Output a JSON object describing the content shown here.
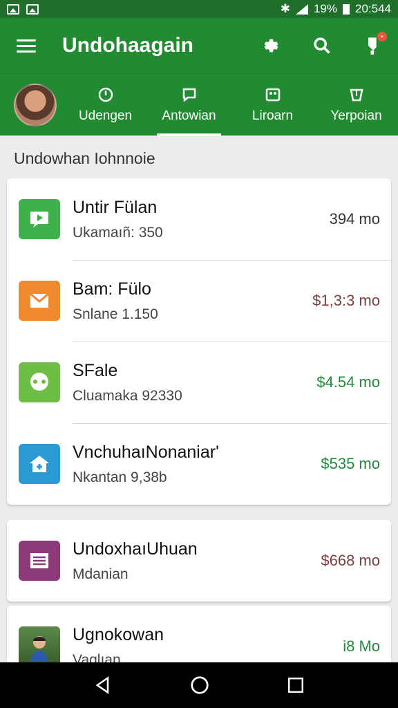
{
  "status_bar": {
    "battery": "19%",
    "time": "20:544"
  },
  "app_bar": {
    "title": "Undohaagain"
  },
  "tabs": [
    {
      "label": "Udengen"
    },
    {
      "label": "Antowian"
    },
    {
      "label": "Liroarn"
    },
    {
      "label": "Yerpoian"
    }
  ],
  "section": {
    "title": "Undowhan Iohnnoie"
  },
  "items": [
    {
      "title": "Untir Fülan",
      "subtitle": "Ukamaıñ: 350",
      "price": "394 mo",
      "icon": "chat-bubble-icon",
      "color": "#3fb14a"
    },
    {
      "title": "Bam: Fülo",
      "subtitle": "Snlane 1.150",
      "price": "$1,3:3 mo",
      "icon": "mail-icon",
      "color": "#f08a2e"
    },
    {
      "title": "SFale",
      "subtitle": "Cluamaka 92330",
      "price": "$4.54 mo",
      "icon": "gamepad-icon",
      "color": "#6cbe45"
    },
    {
      "title": "VnchuhaıNonaniar'",
      "subtitle": "Nkantan 9,38b",
      "price": "$535 mo",
      "icon": "home-icon",
      "color": "#2a9ad4"
    },
    {
      "title": "UndoxhaıUhuan",
      "subtitle": "Mdanian",
      "price": "$668 mo",
      "icon": "list-icon",
      "color": "#8e3a7a"
    },
    {
      "title": "Ugnokowan",
      "subtitle": "Vaglıan",
      "price": "i8 Mo",
      "icon": "photo-icon",
      "color": "#4a7a3a"
    }
  ]
}
